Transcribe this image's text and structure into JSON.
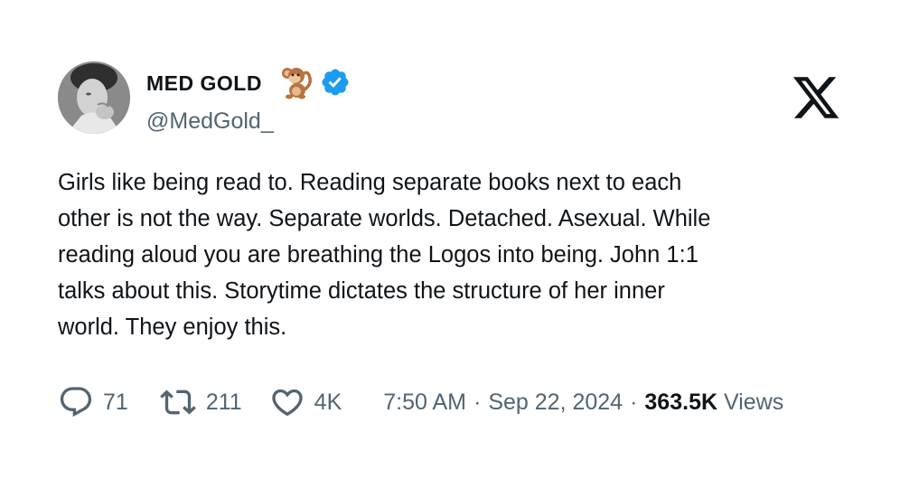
{
  "author": {
    "display_name": "MED GOLD",
    "handle": "@MedGold_",
    "name_emoji": "monkey-icon",
    "verified": true,
    "verified_color": "#1d9bf0"
  },
  "platform_logo": "x-logo-icon",
  "tweet": {
    "text": "Girls like being read to. Reading separate books next to each\nother is not the way. Separate worlds. Detached. Asexual. While\nreading aloud you are breathing the Logos into being. John 1:1\ntalks about this. Storytime dictates the structure of her inner\nworld. They enjoy this."
  },
  "actions": {
    "replies": "71",
    "reposts": "211",
    "likes": "4K"
  },
  "meta": {
    "time": "7:50 AM",
    "separator": "·",
    "date": "Sep 22, 2024",
    "views_count": "363.5K",
    "views_label": "Views"
  },
  "colors": {
    "text_primary": "#0f1419",
    "text_secondary": "#536471",
    "background": "#ffffff"
  }
}
